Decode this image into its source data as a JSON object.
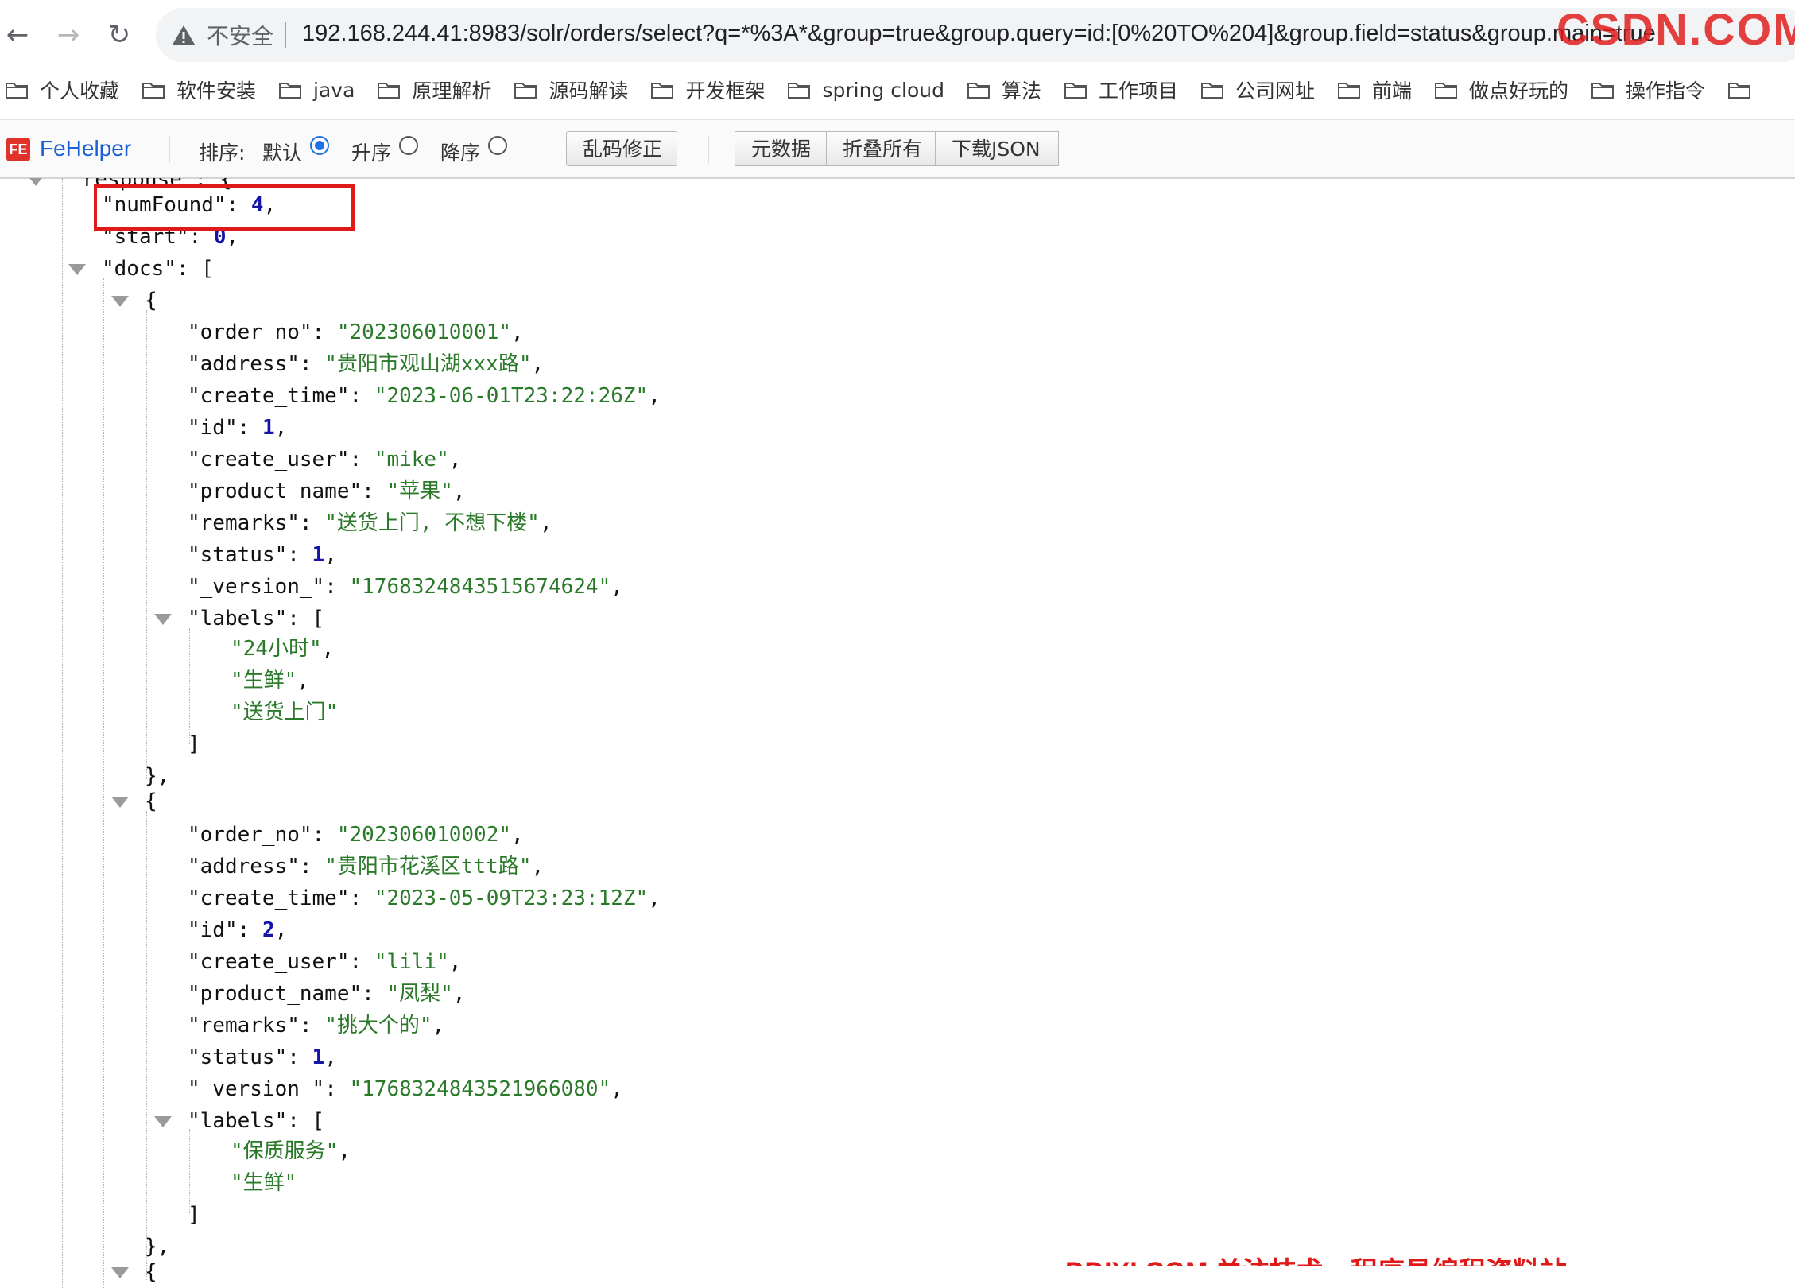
{
  "browser": {
    "back_icon": "arrow-left-icon",
    "forward_icon": "arrow-right-icon",
    "reload_icon": "reload-icon",
    "security_icon": "warning-triangle-icon",
    "security_label": "不安全",
    "url_host": "192.168.244.41",
    "url_rest": ":8983/solr/orders/select?q=*%3A*&group=true&group.query=id:[0%20TO%204]&group.field=status&group.main=true"
  },
  "bookmarks": [
    {
      "label": "个人收藏",
      "icon": "folder-icon"
    },
    {
      "label": "软件安装",
      "icon": "folder-icon"
    },
    {
      "label": "java",
      "icon": "folder-icon"
    },
    {
      "label": "原理解析",
      "icon": "folder-icon"
    },
    {
      "label": "源码解读",
      "icon": "folder-icon"
    },
    {
      "label": "开发框架",
      "icon": "folder-icon"
    },
    {
      "label": "spring cloud",
      "icon": "folder-icon"
    },
    {
      "label": "算法",
      "icon": "folder-icon"
    },
    {
      "label": "工作项目",
      "icon": "folder-icon"
    },
    {
      "label": "公司网址",
      "icon": "folder-icon"
    },
    {
      "label": "前端",
      "icon": "folder-icon"
    },
    {
      "label": "做点好玩的",
      "icon": "folder-icon"
    },
    {
      "label": "操作指令",
      "icon": "folder-icon"
    },
    {
      "label": "",
      "icon": "folder-icon"
    }
  ],
  "fehelper": {
    "logo_text": "FE",
    "name": "FeHelper",
    "sort_label": "排序:",
    "sort_options": [
      {
        "label": "默认",
        "checked": true
      },
      {
        "label": "升序",
        "checked": false
      },
      {
        "label": "降序",
        "checked": false
      }
    ],
    "fix_encoding_button": "乱码修正",
    "metadata_button": "元数据",
    "collapse_all_button": "折叠所有",
    "download_json_button": "下载JSON"
  },
  "json_view": {
    "partial_top_line": "\"response\": {",
    "numFound_key": "\"numFound\"",
    "numFound_value": "4",
    "start_key": "\"start\"",
    "start_value": "0",
    "docs_key": "\"docs\"",
    "docs": [
      {
        "order_no": "\"202306010001\"",
        "address": "\"贵阳市观山湖xxx路\"",
        "create_time": "\"2023-06-01T23:22:26Z\"",
        "id": "1",
        "create_user": "\"mike\"",
        "product_name": "\"苹果\"",
        "remarks": "\"送货上门, 不想下楼\"",
        "status": "1",
        "version": "\"1768324843515674624\"",
        "labels": [
          "\"24小时\"",
          "\"生鲜\"",
          "\"送货上门\""
        ]
      },
      {
        "order_no": "\"202306010002\"",
        "address": "\"贵阳市花溪区ttt路\"",
        "create_time": "\"2023-05-09T23:23:12Z\"",
        "id": "2",
        "create_user": "\"lili\"",
        "product_name": "\"凤梨\"",
        "remarks": "\"挑大个的\"",
        "status": "1",
        "version": "\"1768324843521966080\"",
        "labels": [
          "\"保质服务\"",
          "\"生鲜\""
        ]
      }
    ]
  },
  "watermark": {
    "top_text": "CSDN.COM",
    "bottom_text": "DDIYI.COM 关注技术，程序员编程资料站"
  },
  "colors": {
    "string": "#2a7a2a",
    "number": "#1414a8",
    "highlight": "#e01919",
    "fehelper_blue": "#1a5fd6"
  }
}
